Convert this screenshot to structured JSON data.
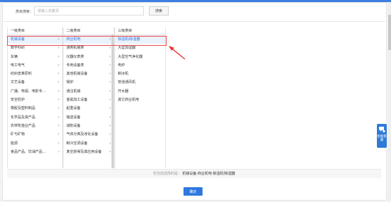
{
  "search": {
    "label": "类目搜索：",
    "placeholder": "请输入关键词",
    "button_label": "搜索"
  },
  "columns": [
    {
      "header": "一级类目",
      "selected_index": 0,
      "items": [
        {
          "label": "机械设备"
        },
        {
          "label": "数学科研"
        },
        {
          "label": "车辆"
        },
        {
          "label": "电工电气"
        },
        {
          "label": "纺织皮革原料"
        },
        {
          "label": "文艺设备"
        },
        {
          "label": "广播、电视、电影专…"
        },
        {
          "label": "安全防护"
        },
        {
          "label": "橡胶及塑料制品"
        },
        {
          "label": "化学品及其产品"
        },
        {
          "label": "农林牧渔业产品"
        },
        {
          "label": "矿与矿物"
        },
        {
          "label": "能源"
        },
        {
          "label": "食品产品、饮油产品…"
        }
      ]
    },
    {
      "header": "二级类目",
      "selected_index": 0,
      "items": [
        {
          "label": "商业机电"
        },
        {
          "label": "通用机械类"
        },
        {
          "label": "仪器仪表类"
        },
        {
          "label": "专用设备类"
        },
        {
          "label": "其他机械设备"
        },
        {
          "label": "锅炉"
        },
        {
          "label": "通注机械"
        },
        {
          "label": "金属加工设备"
        },
        {
          "label": "起重设备"
        },
        {
          "label": "输送设备"
        },
        {
          "label": "减粉设备"
        },
        {
          "label": "气体分离及液化设备"
        },
        {
          "label": "制冷空调设备"
        },
        {
          "label": "真空获得及其应用设备"
        }
      ]
    },
    {
      "header": "三级类目",
      "selected_index": 0,
      "items": [
        {
          "label": "除湿机/除湿器"
        },
        {
          "label": "大型加湿器"
        },
        {
          "label": "大型空气净化器"
        },
        {
          "label": "电炉"
        },
        {
          "label": "制冰机"
        },
        {
          "label": "管道通风机"
        },
        {
          "label": "开水器"
        },
        {
          "label": "其它商业机电"
        }
      ]
    }
  ],
  "selected": {
    "prefix": "您当前选择的是：",
    "path": "机械设备-商业机电-除湿机/除湿器"
  },
  "confirm_label": "确定",
  "service_widget": {
    "label": "智能客服"
  },
  "colors": {
    "accent": "#2e78e0",
    "highlight_border": "#ef4b4b",
    "selected_bg": "#eaf2fd"
  },
  "icons": {
    "chevron": "chevron-right-icon",
    "arrow": "annotation-arrow-icon",
    "service": "chat-bubble-icon"
  }
}
